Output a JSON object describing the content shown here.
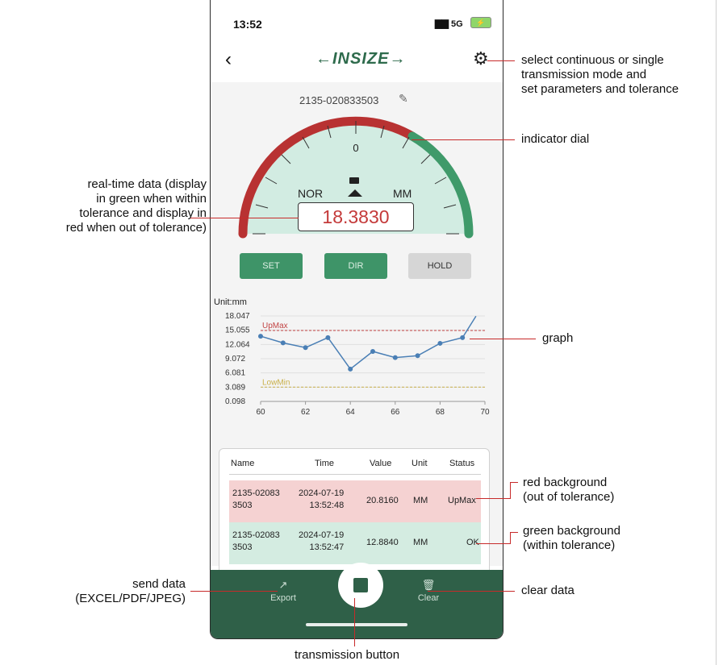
{
  "status_bar": {
    "time": "13:52",
    "network": "5G"
  },
  "header": {
    "brand": "INSIZE",
    "back_icon": "chevron-left-icon",
    "settings_icon": "gear-icon"
  },
  "device": {
    "id": "2135-020833503",
    "edit_icon": "edit-icon"
  },
  "dial": {
    "zero_label": "0",
    "mode": "NOR",
    "unit": "MM",
    "reading": "18.3830",
    "reading_color": "#c43a3a"
  },
  "buttons": {
    "set": "SET",
    "dir": "DIR",
    "hold": "HOLD"
  },
  "chart_data": {
    "type": "line",
    "title": "Unit:mm",
    "xlim": [
      60,
      70
    ],
    "ylim": [
      0.098,
      18.047
    ],
    "x_ticks": [
      "60",
      "62",
      "64",
      "66",
      "68",
      "70"
    ],
    "y_ticks": [
      "18.047",
      "15.055",
      "12.064",
      "9.072",
      "6.081",
      "3.089",
      "0.098"
    ],
    "x": [
      60,
      61,
      62,
      63,
      64,
      65,
      66,
      67,
      68,
      69,
      69.6
    ],
    "y": [
      13.8,
      12.4,
      11.4,
      13.5,
      6.9,
      10.6,
      9.3,
      9.7,
      12.3,
      13.5,
      18.0
    ],
    "references": [
      {
        "label": "UpMax",
        "value": 15.0,
        "color": "#c24545"
      },
      {
        "label": "LowMin",
        "value": 3.1,
        "color": "#c9b04a"
      }
    ],
    "series_color": "#4a7fb5",
    "grid": true
  },
  "table": {
    "columns": [
      "Name",
      "Time",
      "Value",
      "Unit",
      "Status"
    ],
    "rows": [
      {
        "name": "2135-02083\n3503",
        "time": "2024-07-19\n13:52:48",
        "value": "20.8160",
        "unit": "MM",
        "status": "UpMax",
        "bg": "#f5d2d2"
      },
      {
        "name": "2135-02083\n3503",
        "time": "2024-07-19\n13:52:47",
        "value": "12.8840",
        "unit": "MM",
        "status": "OK",
        "bg": "#d4ece1"
      }
    ]
  },
  "bottom_bar": {
    "export_label": "Export",
    "export_icon": "share-icon",
    "clear_label": "Clear",
    "clear_icon": "trash-icon"
  },
  "annotations": {
    "settings": "select continuous or single\ntransmission mode and\nset parameters and tolerance",
    "dial": "indicator dial",
    "realtime": "real-time data (display\nin green when within\ntolerance and display in\nred when out of tolerance)",
    "graph": "graph",
    "red_bg": "red background\n(out of tolerance)",
    "green_bg": "green background\n(within tolerance)",
    "send": "send data\n(EXCEL/PDF/JPEG)",
    "clear": "clear data",
    "transmission": "transmission button"
  },
  "colors": {
    "accent_green": "#2f6048",
    "dial_red": "#b83232",
    "dial_green": "#3f9a6a",
    "annotation_line": "#c72a2a"
  }
}
